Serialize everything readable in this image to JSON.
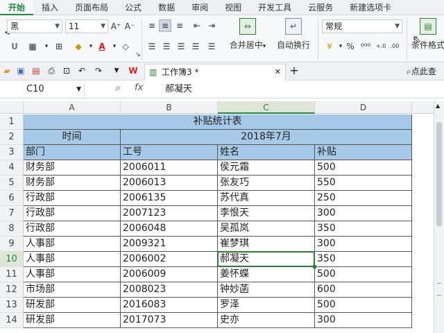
{
  "menu": {
    "tabs": [
      "开始",
      "插入",
      "页面布局",
      "公式",
      "数据",
      "审阅",
      "视图",
      "开发工具",
      "云服务",
      "新建选项卡"
    ],
    "active_index": 0
  },
  "ribbon": {
    "font_name": "黑",
    "font_size": "11",
    "merge_center_label": "合并居中",
    "wrap_text_label": "自动换行",
    "number_format": "常规",
    "cond_format_label": "条件格式",
    "percent": "%"
  },
  "quickbar": {
    "doc_name": "工作簿3 *",
    "search_label": "点此查"
  },
  "formula_bar": {
    "cell_ref": "C10",
    "fx": "fx",
    "value": "郝凝天"
  },
  "sheet": {
    "columns": [
      "A",
      "B",
      "C",
      "D"
    ],
    "selected_column": "C",
    "selected_row": 10,
    "row_numbers": [
      1,
      2,
      3,
      4,
      5,
      6,
      7,
      8,
      9,
      10,
      11,
      12,
      13,
      14
    ],
    "title": "补贴统计表",
    "time_label": "时间",
    "period": "2018年7月",
    "headers": [
      "部门",
      "工号",
      "姓名",
      "补贴"
    ],
    "rows": [
      [
        "财务部",
        "2006011",
        "侯元霜",
        "500"
      ],
      [
        "财务部",
        "2006013",
        "张友巧",
        "550"
      ],
      [
        "行政部",
        "2006135",
        "苏代真",
        "250"
      ],
      [
        "行政部",
        "2007123",
        "李恨天",
        "300"
      ],
      [
        "行政部",
        "2006048",
        "吴孤岚",
        "350"
      ],
      [
        "人事部",
        "2009321",
        "崔梦琪",
        "300"
      ],
      [
        "人事部",
        "2006002",
        "郝凝天",
        "350"
      ],
      [
        "人事部",
        "2006009",
        "姜怀蝶",
        "500"
      ],
      [
        "市场部",
        "2008023",
        "钟妙菡",
        "600"
      ],
      [
        "研发部",
        "2016083",
        "罗泽",
        "500"
      ],
      [
        "研发部",
        "2017073",
        "史亦",
        "300"
      ]
    ]
  },
  "colors": {
    "accent": "#1f8a3d",
    "header_fill": "#a6c9e8"
  }
}
